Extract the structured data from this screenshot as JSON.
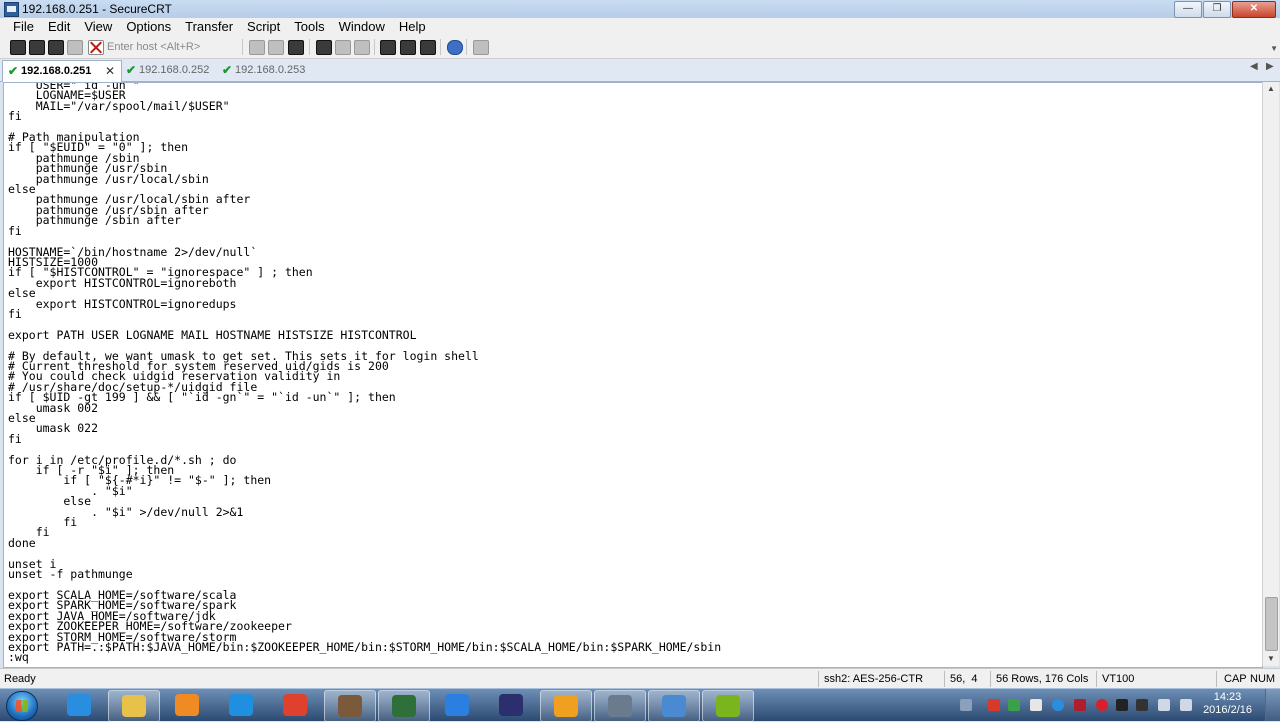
{
  "window": {
    "title": "192.168.0.251 - SecureCRT",
    "controls": {
      "minimize": "—",
      "maximize": "❐",
      "close": "✕"
    }
  },
  "menu": [
    "File",
    "Edit",
    "View",
    "Options",
    "Transfer",
    "Script",
    "Tools",
    "Window",
    "Help"
  ],
  "toolbar": {
    "quick_connect_placeholder": "Enter host <Alt+R>"
  },
  "tabs": [
    {
      "label": "192.168.0.251",
      "active": true,
      "connected": true
    },
    {
      "label": "192.168.0.252",
      "active": false,
      "connected": true
    },
    {
      "label": "192.168.0.253",
      "active": false,
      "connected": true
    }
  ],
  "terminal": {
    "lines": [
      "    USER=\"`id -un`\"",
      "    LOGNAME=$USER",
      "    MAIL=\"/var/spool/mail/$USER\"",
      "fi",
      "",
      "# Path manipulation",
      "if [ \"$EUID\" = \"0\" ]; then",
      "    pathmunge /sbin",
      "    pathmunge /usr/sbin",
      "    pathmunge /usr/local/sbin",
      "else",
      "    pathmunge /usr/local/sbin after",
      "    pathmunge /usr/sbin after",
      "    pathmunge /sbin after",
      "fi",
      "",
      "HOSTNAME=`/bin/hostname 2>/dev/null`",
      "HISTSIZE=1000",
      "if [ \"$HISTCONTROL\" = \"ignorespace\" ] ; then",
      "    export HISTCONTROL=ignoreboth",
      "else",
      "    export HISTCONTROL=ignoredups",
      "fi",
      "",
      "export PATH USER LOGNAME MAIL HOSTNAME HISTSIZE HISTCONTROL",
      "",
      "# By default, we want umask to get set. This sets it for login shell",
      "# Current threshold for system reserved uid/gids is 200",
      "# You could check uidgid reservation validity in",
      "# /usr/share/doc/setup-*/uidgid file",
      "if [ $UID -gt 199 ] && [ \"`id -gn`\" = \"`id -un`\" ]; then",
      "    umask 002",
      "else",
      "    umask 022",
      "fi",
      "",
      "for i in /etc/profile.d/*.sh ; do",
      "    if [ -r \"$i\" ]; then",
      "        if [ \"${-#*i}\" != \"$-\" ]; then",
      "            . \"$i\"",
      "        else",
      "            . \"$i\" >/dev/null 2>&1",
      "        fi",
      "    fi",
      "done",
      "",
      "unset i",
      "unset -f pathmunge",
      "",
      "export SCALA_HOME=/software/scala",
      "export SPARK_HOME=/software/spark",
      "export JAVA_HOME=/software/jdk",
      "export ZOOKEEPER_HOME=/software/zookeeper",
      "export STORM_HOME=/software/storm",
      "export PATH=.:$PATH:$JAVA_HOME/bin:$ZOOKEEPER_HOME/bin:$STORM_HOME/bin:$SCALA_HOME/bin:$SPARK_HOME/sbin",
      ":wq"
    ]
  },
  "status": {
    "ready": "Ready",
    "cipher": "ssh2: AES-256-CTR",
    "cursor": "56,  4",
    "size": "56 Rows, 176 Cols",
    "emulation": "VT100",
    "caps": "CAP",
    "num": "NUM"
  },
  "taskbar": {
    "time": "14:23",
    "date": "2016/2/16",
    "apps": [
      {
        "icon": "internet-explorer-icon",
        "color": "#2a8ee0",
        "open": false
      },
      {
        "icon": "file-explorer-icon",
        "color": "#e8c14a",
        "open": true
      },
      {
        "icon": "media-player-icon",
        "color": "#f08a24",
        "open": false
      },
      {
        "icon": "network-app-icon",
        "color": "#1f8fe0",
        "open": false
      },
      {
        "icon": "chrome-icon",
        "color": "#e0412f",
        "open": false
      },
      {
        "icon": "utility-tool-icon",
        "color": "#7a5a3a",
        "open": true
      },
      {
        "icon": "network-connect-icon",
        "color": "#2f6f3a",
        "open": true
      },
      {
        "icon": "notes-app-icon",
        "color": "#2b7fe0",
        "open": false
      },
      {
        "icon": "eclipse-icon",
        "color": "#2c2f6e",
        "open": false
      },
      {
        "icon": "virtualbox-icon",
        "color": "#f0a020",
        "open": true
      },
      {
        "icon": "securecrt-icon",
        "color": "#6b7b8e",
        "open": true
      },
      {
        "icon": "remote-desktop-icon",
        "color": "#4a8ad0",
        "open": true
      },
      {
        "icon": "mindmap-icon",
        "color": "#7ab51d",
        "open": true
      }
    ]
  }
}
